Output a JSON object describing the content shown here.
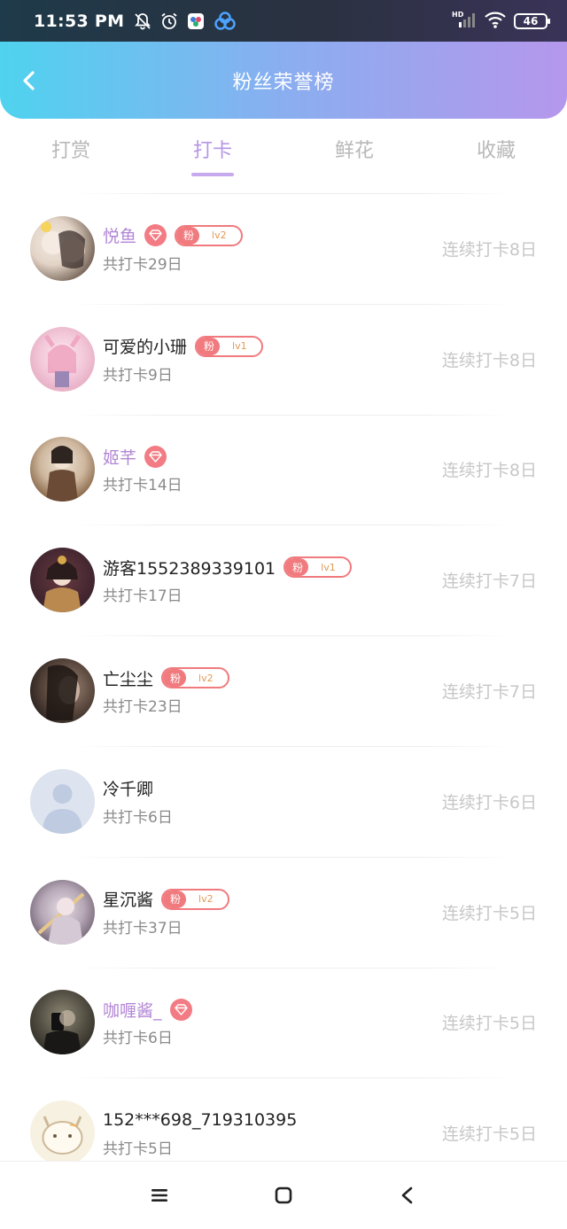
{
  "status_bar": {
    "time": "11:53 PM",
    "battery": "46",
    "hd_label": "HD",
    "icons": [
      "bell-off-icon",
      "alarm-icon",
      "app-icon",
      "app-icon-2",
      "signal-icon",
      "wifi-icon",
      "battery-icon"
    ]
  },
  "header": {
    "title": "粉丝荣誉榜",
    "back_icon": "chevron-left-icon"
  },
  "tabs": [
    {
      "label": "打赏",
      "active": false
    },
    {
      "label": "打卡",
      "active": true
    },
    {
      "label": "鲜花",
      "active": false
    },
    {
      "label": "收藏",
      "active": false
    }
  ],
  "badge_text": {
    "fan": "粉"
  },
  "rows": [
    {
      "name": "悦鱼",
      "name_color": "purple",
      "gem": true,
      "fan_level": "lv2",
      "count": "共打卡29日",
      "streak": "连续打卡8日"
    },
    {
      "name": "可爱的小珊",
      "name_color": "default",
      "gem": false,
      "fan_level": "lv1",
      "count": "共打卡9日",
      "streak": "连续打卡8日"
    },
    {
      "name": "姬芊",
      "name_color": "purple",
      "gem": true,
      "fan_level": "",
      "count": "共打卡14日",
      "streak": "连续打卡8日"
    },
    {
      "name": "游客1552389339101",
      "name_color": "default",
      "gem": false,
      "fan_level": "lv1",
      "count": "共打卡17日",
      "streak": "连续打卡7日"
    },
    {
      "name": "亡尘尘",
      "name_color": "default",
      "gem": false,
      "fan_level": "lv2",
      "count": "共打卡23日",
      "streak": "连续打卡7日"
    },
    {
      "name": "冷千卿",
      "name_color": "default",
      "gem": false,
      "fan_level": "",
      "count": "共打卡6日",
      "streak": "连续打卡6日"
    },
    {
      "name": "星沉酱",
      "name_color": "default",
      "gem": false,
      "fan_level": "lv2",
      "count": "共打卡37日",
      "streak": "连续打卡5日"
    },
    {
      "name": "咖喱酱_",
      "name_color": "purple",
      "gem": true,
      "fan_level": "",
      "count": "共打卡6日",
      "streak": "连续打卡5日"
    },
    {
      "name": "152***698_719310395",
      "name_color": "default",
      "gem": false,
      "fan_level": "",
      "count": "共打卡5日",
      "streak": "连续打卡5日"
    }
  ],
  "colors": {
    "header_gradient_start": "#4fd3ef",
    "header_gradient_end": "#b597ec",
    "active_tab": "#b596e6",
    "purple_name": "#b286d6",
    "badge_red": "#f07a7e",
    "streak_gray": "#c7c7c7"
  },
  "navbar": {
    "icons": [
      "menu-icon",
      "home-square-icon",
      "back-triangle-icon"
    ]
  }
}
